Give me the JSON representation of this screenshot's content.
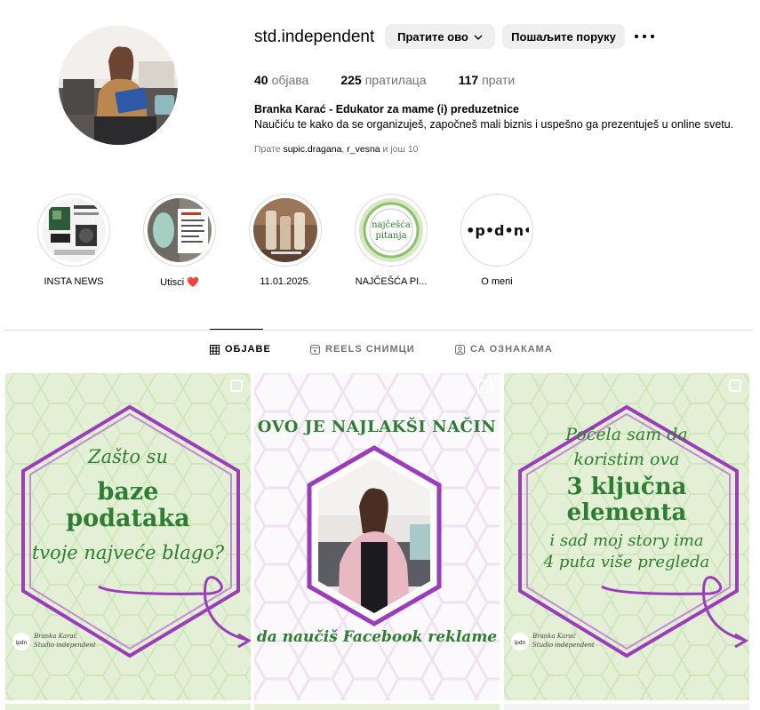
{
  "profile": {
    "username": "std.independent",
    "follow_label": "Пратите ово",
    "message_label": "Пошаљите поруку",
    "stats": {
      "posts_count": "40",
      "posts_label": "објава",
      "followers_count": "225",
      "followers_label": "пратилаца",
      "following_count": "117",
      "following_label": "прати"
    },
    "full_name": "Branka Karać - Edukator za mame (i) preduzetnice",
    "bio": "Naučiću te kako da se organizuješ, započneš mali biznis i uspešno ga prezentuješ u online svetu.",
    "followed_by": {
      "prefix": "Прате",
      "user1": "supic.dragana",
      "sep": ",",
      "user2": "r_vesna",
      "suffix": "и још 10"
    }
  },
  "highlights": [
    {
      "label": "INSTA NEWS",
      "icon": "news-collage-thumb"
    },
    {
      "label": "Utisci ❤️",
      "icon": "testimonials-thumb"
    },
    {
      "label": "11.01.2025.",
      "icon": "drinks-thumb"
    },
    {
      "label": "NAJČEŠĆA PI...",
      "icon": "faq-thumb",
      "thumb_text_1": "najčešća",
      "thumb_text_2": "pitanja"
    },
    {
      "label": "O meni",
      "icon": "ipdn-logo-thumb",
      "thumb_text": "i•p•d•n•"
    }
  ],
  "tabs": [
    {
      "label": "ОБЈАВЕ",
      "icon": "grid-icon",
      "active": true
    },
    {
      "label": "REELS СНИМЦИ",
      "icon": "reels-icon",
      "active": false
    },
    {
      "label": "СА ОЗНАКАМА",
      "icon": "tagged-icon",
      "active": false
    }
  ],
  "posts": [
    {
      "line1": "Zašto su",
      "line2": "baze",
      "line3": "podataka",
      "line4": "tvoje najveće blago?",
      "brand_name": "Branka Karać",
      "brand_sub": "Studio independent",
      "brand_logo": "ipdn"
    },
    {
      "top": "OVO JE NAJLAKŠI NAČIN",
      "bottom": "da naučiš Facebook reklame"
    },
    {
      "line1": "Počela sam da",
      "line2": "koristim ova",
      "line3": "3 ključna",
      "line4": "elementa",
      "line5": "i sad moj story ima",
      "line6": "4 puta više pregleda",
      "brand_name": "Branka Karać",
      "brand_sub": "Studio independent",
      "brand_logo": "ipdn"
    }
  ],
  "colors": {
    "post_green_bg": "#e3f0d6",
    "post_green_text": "#2e7d32",
    "post_purple": "#9b3dbb",
    "muted": "#737373",
    "button_bg": "#efefef"
  }
}
